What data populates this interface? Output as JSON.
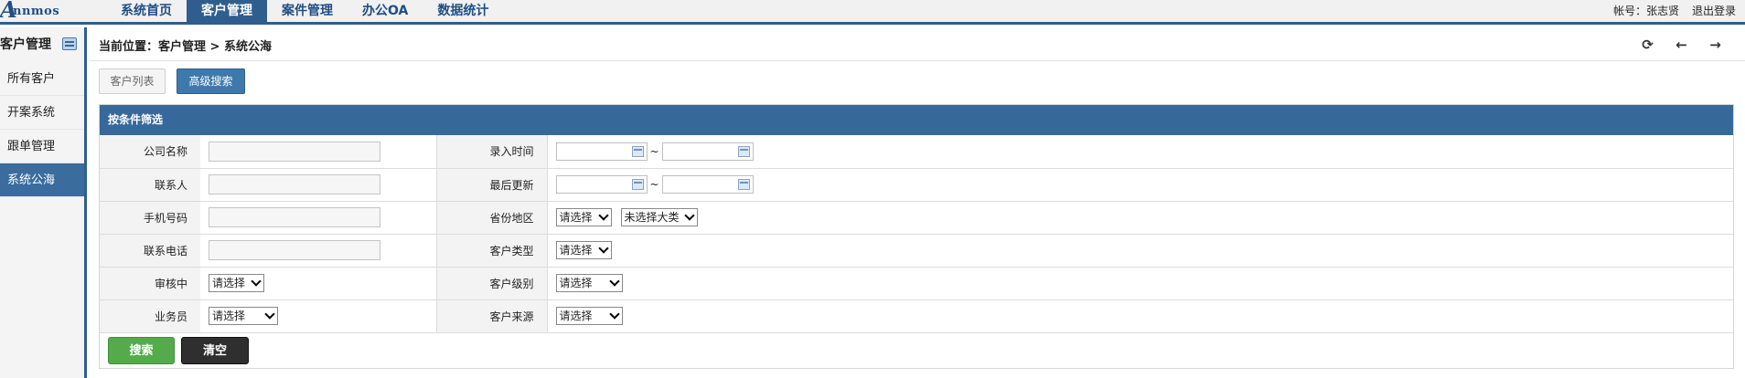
{
  "logo": {
    "letter": "A",
    "rest": "nnmos"
  },
  "nav": [
    "系统首页",
    "客户管理",
    "案件管理",
    "办公OA",
    "数据统计"
  ],
  "user": {
    "account": "帐号：张志贤",
    "logout": "退出登录"
  },
  "sidebar": {
    "title": "客户管理",
    "items": [
      {
        "label": "所有客户"
      },
      {
        "label": "开案系统"
      },
      {
        "label": "跟单管理"
      },
      {
        "label": "系统公海"
      }
    ]
  },
  "breadcrumb": "当前位置：客户管理 > 系统公海",
  "tabs": {
    "list": "客户列表",
    "advanced": "高级搜索"
  },
  "panel": {
    "title": "按条件筛选",
    "rows": [
      {
        "label1": "公司名称",
        "label2": "录入时间"
      },
      {
        "label1": "联系人",
        "label2": "最后更新"
      },
      {
        "label1": "手机号码",
        "label2": "省份地区"
      },
      {
        "label1": "联系电话",
        "label2": "客户类型"
      },
      {
        "label1": "审核中",
        "label2": "客户级别"
      },
      {
        "label1": "业务员",
        "label2": "客户来源"
      }
    ],
    "date_sep": "~",
    "selects": {
      "province": "请选择",
      "category": "未选择大类",
      "customer_type": "请选择",
      "review": "请选择",
      "level": "请选择",
      "salesman": "请选择",
      "source": "请选择"
    },
    "buttons": {
      "search": "搜索",
      "clear": "清空"
    }
  },
  "icons": {
    "sidebar": "list-icon",
    "refresh": "refresh-icon",
    "back": "arrow-left-icon",
    "forward": "arrow-right-icon",
    "calendar": "calendar-icon"
  },
  "colors": {
    "primary": "#2f5e8e",
    "panel_header": "#36699a",
    "search_button": "#55ab4c",
    "clear_button": "#2f2f2f"
  }
}
